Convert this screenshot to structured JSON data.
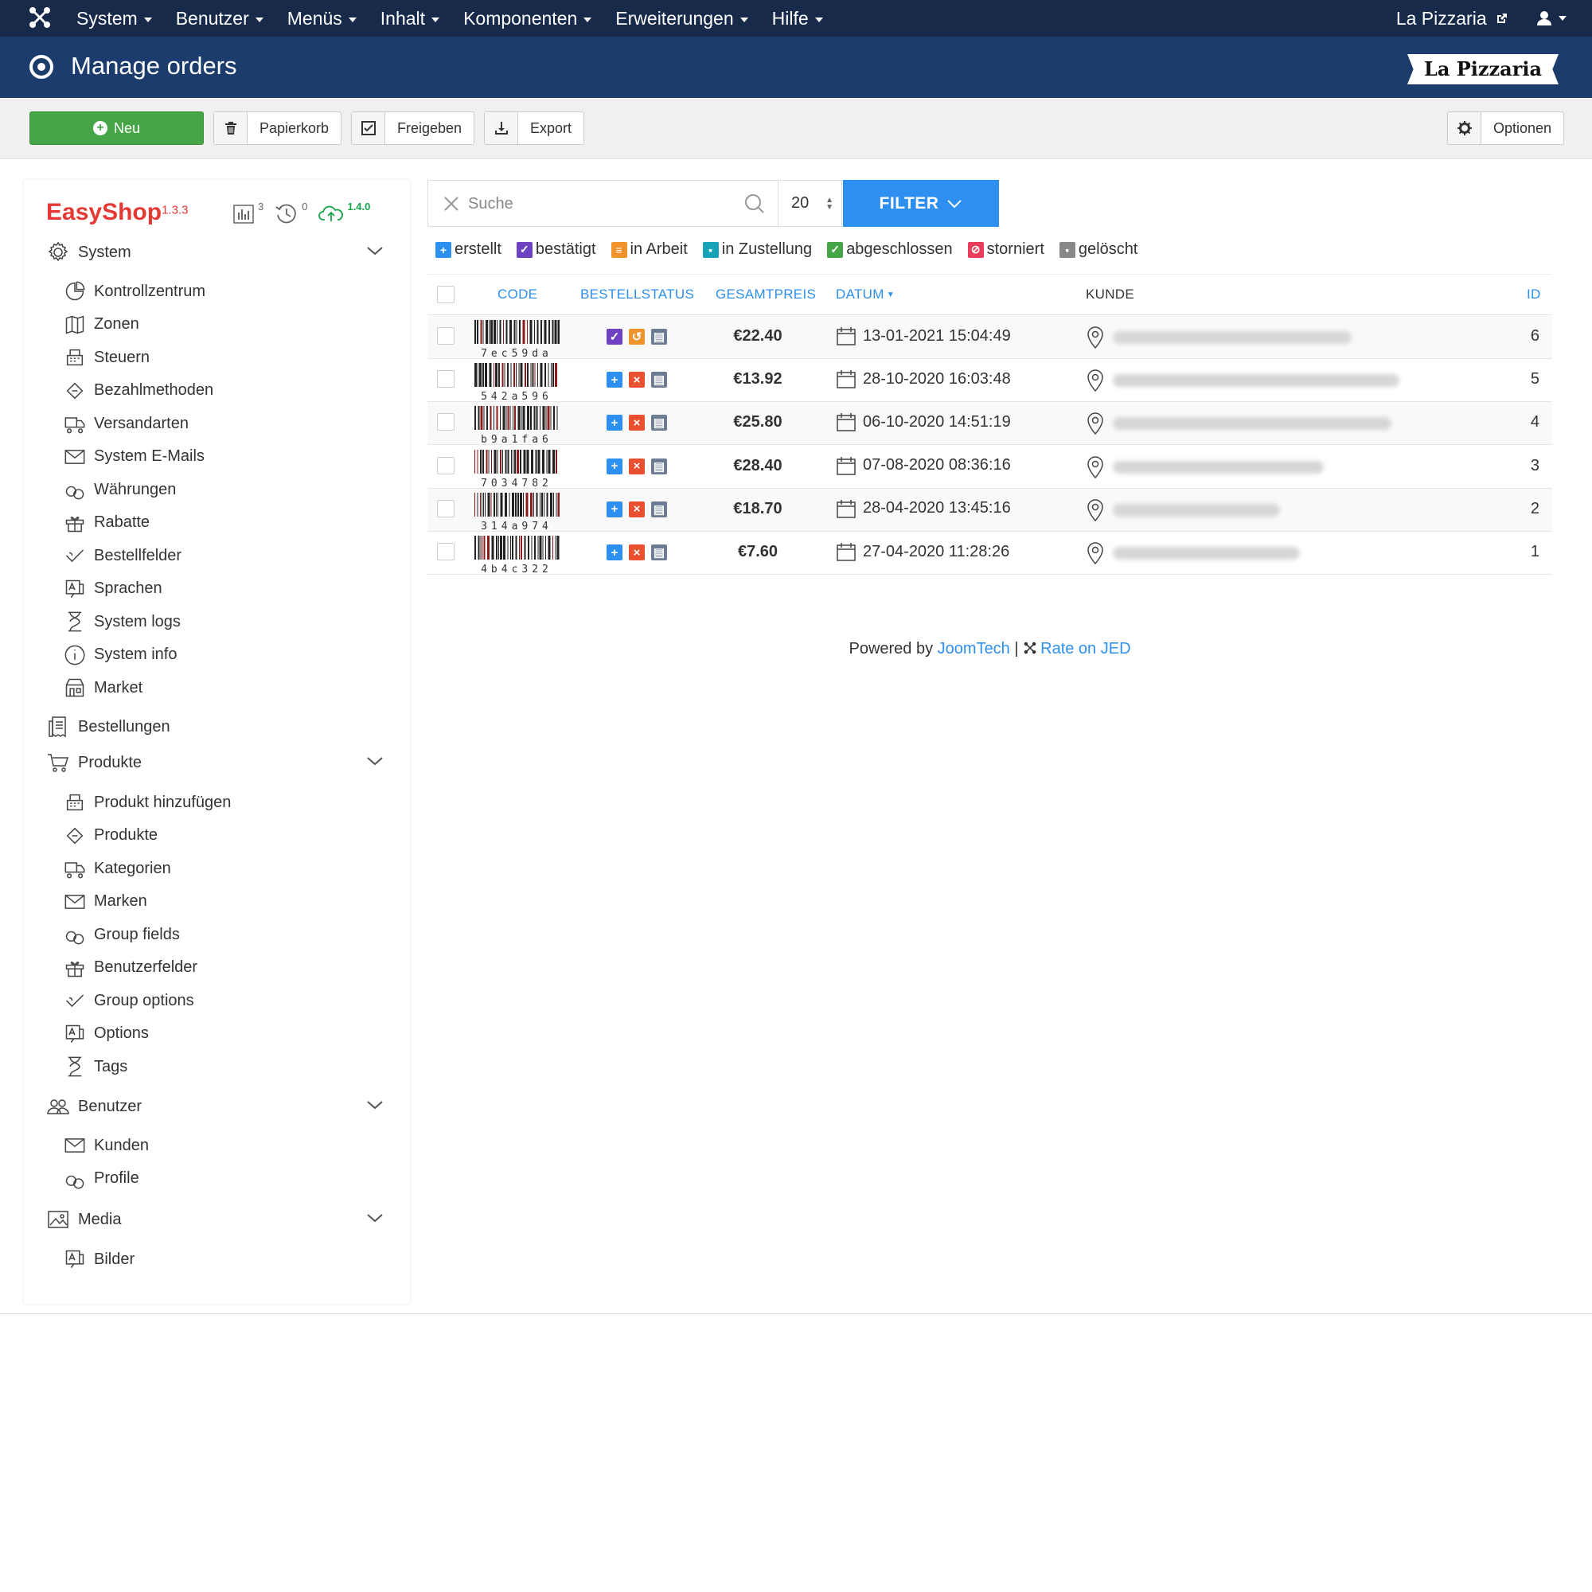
{
  "topbar": {
    "menus": [
      "System",
      "Benutzer",
      "Menüs",
      "Inhalt",
      "Komponenten",
      "Erweiterungen",
      "Hilfe"
    ],
    "site_name": "La Pizzaria"
  },
  "header": {
    "title": "Manage orders",
    "brand": "La Pizzaria"
  },
  "toolbar": {
    "new_label": "Neu",
    "trash_label": "Papierkorb",
    "publish_label": "Freigeben",
    "export_label": "Export",
    "options_label": "Optionen"
  },
  "sidebar": {
    "app_name": "EasyShop",
    "app_version": "1.3.3",
    "badge_stats": "3",
    "badge_history": "0",
    "badge_update": "1.4.0",
    "system_label": "System",
    "system_items": [
      "Kontrollzentrum",
      "Zonen",
      "Steuern",
      "Bezahlmethoden",
      "Versandarten",
      "System E-Mails",
      "Währungen",
      "Rabatte",
      "Bestellfelder",
      "Sprachen",
      "System logs",
      "System info",
      "Market"
    ],
    "orders_label": "Bestellungen",
    "products_label": "Produkte",
    "products_items": [
      "Produkt hinzufügen",
      "Produkte",
      "Kategorien",
      "Marken",
      "Group fields",
      "Benutzerfelder",
      "Group options",
      "Options",
      "Tags"
    ],
    "users_label": "Benutzer",
    "users_items": [
      "Kunden",
      "Profile"
    ],
    "media_label": "Media",
    "media_items": [
      "Bilder"
    ]
  },
  "search": {
    "placeholder": "Suche",
    "limit": "20",
    "filter_label": "FILTER"
  },
  "legend": [
    {
      "label": "erstellt",
      "color": "#2d8ff0"
    },
    {
      "label": "bestätigt",
      "color": "#6f42c1"
    },
    {
      "label": "in Arbeit",
      "color": "#f0932b"
    },
    {
      "label": "in Zustellung",
      "color": "#17a2b8"
    },
    {
      "label": "abgeschlossen",
      "color": "#46a546"
    },
    {
      "label": "storniert",
      "color": "#e83e5c"
    },
    {
      "label": "gelöscht",
      "color": "#888888"
    }
  ],
  "table": {
    "headers": {
      "code": "CODE",
      "status": "BESTELLSTATUS",
      "total": "GESAMTPREIS",
      "date": "DATUM",
      "customer": "KUNDE",
      "id": "ID"
    },
    "rows": [
      {
        "code": "7ec59da",
        "status": "confirmed",
        "total": "€22.40",
        "date": "13-01-2021 15:04:49",
        "id": "6"
      },
      {
        "code": "542a596",
        "status": "created",
        "total": "€13.92",
        "date": "28-10-2020 16:03:48",
        "id": "5"
      },
      {
        "code": "b9a1fa6",
        "status": "created",
        "total": "€25.80",
        "date": "06-10-2020 14:51:19",
        "id": "4"
      },
      {
        "code": "7034782",
        "status": "created",
        "total": "€28.40",
        "date": "07-08-2020 08:36:16",
        "id": "3"
      },
      {
        "code": "314a974",
        "status": "created",
        "total": "€18.70",
        "date": "28-04-2020 13:45:16",
        "id": "2"
      },
      {
        "code": "4b4c322",
        "status": "created",
        "total": "€7.60",
        "date": "27-04-2020 11:28:26",
        "id": "1"
      }
    ]
  },
  "footer": {
    "powered_prefix": "Powered by ",
    "powered_link": "JoomTech",
    "separator": " | ",
    "rate_link": "Rate on JED"
  }
}
